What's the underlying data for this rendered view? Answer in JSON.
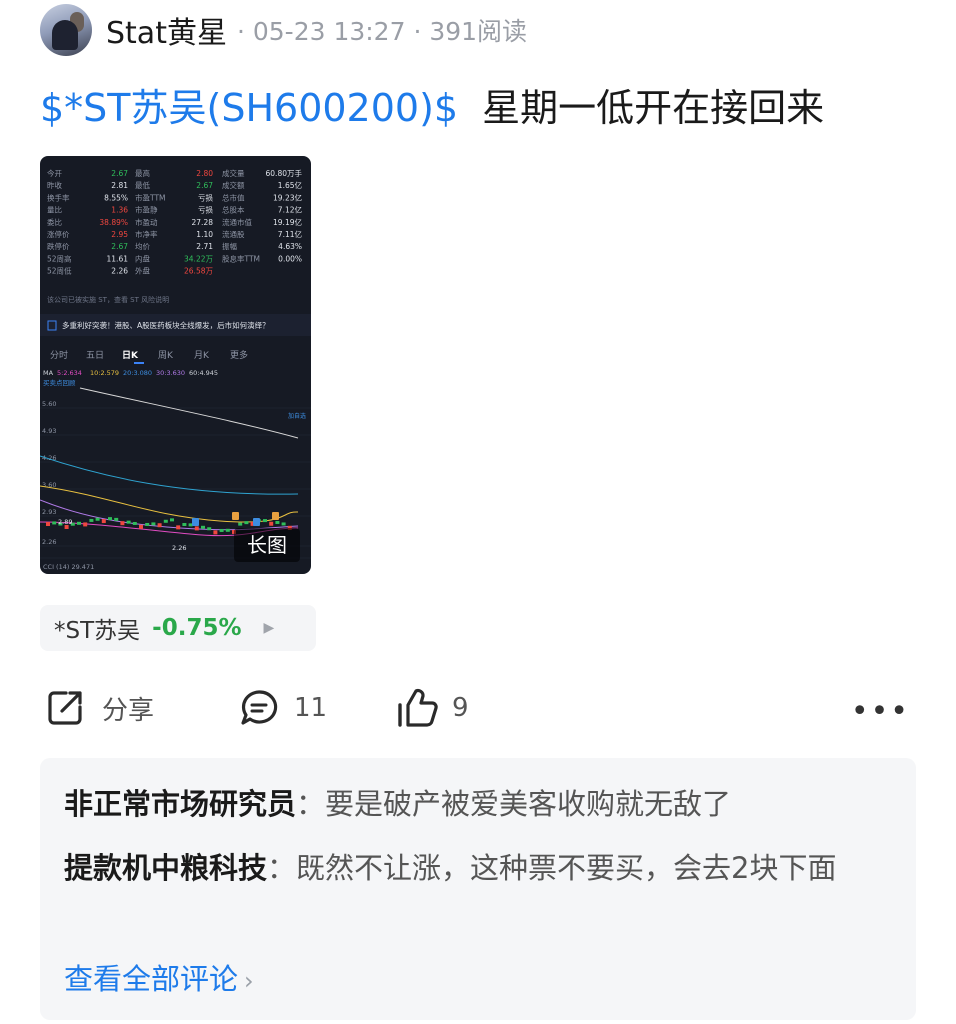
{
  "post": {
    "author": "Stat黄星",
    "time": "05-23 13:27",
    "reads": "391阅读",
    "stock_tag": "$*ST苏吴(SH600200)$",
    "title_text": "星期一低开在接回来",
    "image_badge": "长图"
  },
  "stock_pill": {
    "name": "*ST苏吴",
    "change": "-0.75%",
    "change_color": "#2aa84a"
  },
  "actions": {
    "share_label": "分享",
    "comment_count": "11",
    "like_count": "9",
    "more_label": "•••"
  },
  "comments": [
    {
      "user": "非正常市场研究员",
      "text": "：要是破产被爱美客收购就无敌了"
    },
    {
      "user": "提款机中粮科技",
      "text": "：既然不让涨，这种票不要买，会去2块下面"
    }
  ],
  "view_all_label": "查看全部评论",
  "thumbnail": {
    "quote_rows": [
      [
        "今开",
        "2.67",
        "最高",
        "2.80",
        "成交量",
        "60.80万手"
      ],
      [
        "昨收",
        "2.81",
        "最低",
        "2.67",
        "成交额",
        "1.65亿"
      ],
      [
        "换手率",
        "8.55%",
        "市盈TTM",
        "亏损",
        "总市值",
        "19.23亿"
      ],
      [
        "量比",
        "1.36",
        "市盈静",
        "亏损",
        "总股本",
        "7.12亿"
      ],
      [
        "委比",
        "38.89%",
        "市盈动",
        "27.28",
        "流通市值",
        "19.19亿"
      ],
      [
        "涨停价",
        "2.95",
        "市净率",
        "1.10",
        "流通股",
        "7.11亿"
      ],
      [
        "跌停价",
        "2.67",
        "均价",
        "2.71",
        "振幅",
        "4.63%"
      ],
      [
        "52周高",
        "11.61",
        "内盘",
        "34.22万",
        "股息率TTM",
        "0.00%"
      ],
      [
        "52周低",
        "2.26",
        "外盘",
        "26.58万",
        "",
        ""
      ]
    ],
    "notice": "该公司已被实施 ST，查看 ST 风险说明",
    "news": "多重利好突袭！港股、A股医药板块全线爆发，后市如何演绎？",
    "tabs": [
      "分时",
      "五日",
      "日K",
      "周K",
      "月K",
      "更多"
    ],
    "ma": [
      "MA",
      "5:2.634",
      "10:2.579",
      "20:3.080",
      "30:3.630",
      "60:4.945"
    ],
    "price_ticks": [
      "5.60",
      "4.93",
      "4.26",
      "3.60",
      "2.93",
      "2.26"
    ],
    "low_label": "2.26",
    "last_label": "2.89",
    "cci": "CCI (14)  29.471",
    "buy_label": "买卖点回顾",
    "add_label": "加自选"
  },
  "colors": {
    "link_blue": "#1e7bea",
    "up_red": "#f0473f",
    "down_green": "#2fbd5a"
  }
}
